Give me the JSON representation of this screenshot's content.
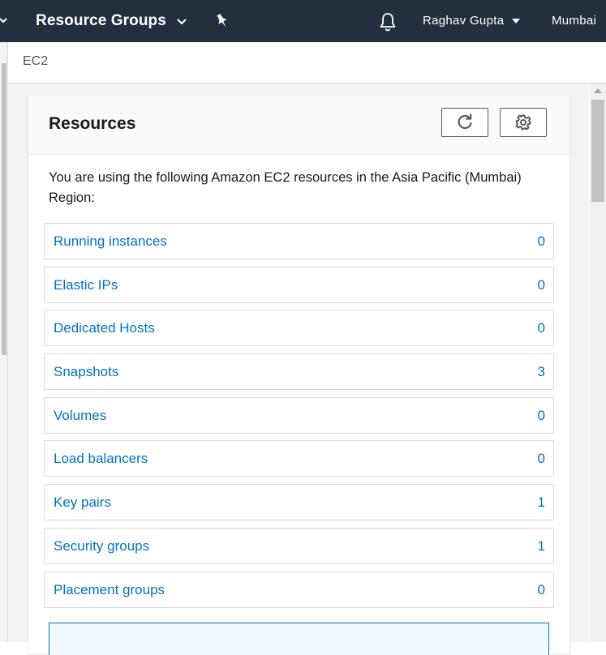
{
  "topnav": {
    "resource_groups_label": "Resource Groups",
    "user_label": "Raghav Gupta",
    "region_label": "Mumbai",
    "icons": [
      "chevron-down-icon",
      "pin-icon",
      "bell-icon",
      "caret-down-icon"
    ]
  },
  "breadcrumb": {
    "service": "EC2"
  },
  "panel": {
    "title": "Resources",
    "intro": "You are using the following Amazon EC2 resources in the Asia Pacific (Mumbai) Region:",
    "buttons": {
      "refresh_icon": "refresh-icon",
      "settings_icon": "gear-icon"
    },
    "resources": [
      {
        "name": "Running instances",
        "count": "0"
      },
      {
        "name": "Elastic IPs",
        "count": "0"
      },
      {
        "name": "Dedicated Hosts",
        "count": "0"
      },
      {
        "name": "Snapshots",
        "count": "3"
      },
      {
        "name": "Volumes",
        "count": "0"
      },
      {
        "name": "Load balancers",
        "count": "0"
      },
      {
        "name": "Key pairs",
        "count": "1"
      },
      {
        "name": "Security groups",
        "count": "1"
      },
      {
        "name": "Placement groups",
        "count": "0"
      }
    ]
  },
  "colors": {
    "nav_bg": "#232f3e",
    "link": "#0073bb",
    "panel_header_bg": "#fafafa",
    "page_bg": "#f2f3f3"
  }
}
